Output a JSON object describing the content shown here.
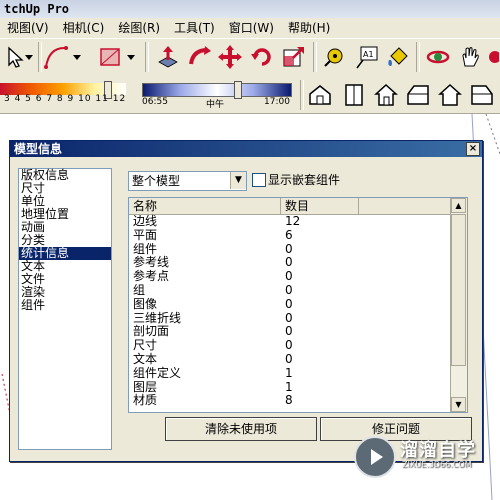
{
  "app": {
    "title": "tchUp Pro"
  },
  "menu": [
    {
      "label": "视图(V)"
    },
    {
      "label": "相机(C)"
    },
    {
      "label": "绘图(R)"
    },
    {
      "label": "工具(T)"
    },
    {
      "label": "窗口(W)"
    },
    {
      "label": "帮助(H)"
    }
  ],
  "toolbar": {
    "tools": [
      "select-arrow-icon",
      "arc-icon",
      "rectangle-icon",
      "push-pull-icon",
      "follow-me-icon",
      "move-icon",
      "rotate-icon",
      "scale-icon",
      "tape-measure-icon",
      "text-label-icon",
      "paint-bucket-icon",
      "orbit-icon",
      "pan-hand-icon"
    ],
    "text_tool_glyph": "A1",
    "views": [
      "iso-view-icon",
      "top-view-icon",
      "front-view-icon",
      "right-view-icon",
      "back-view-icon",
      "left-view-icon"
    ]
  },
  "shadow": {
    "month_ticks": "3 4 5 6 7 8 9 10 11 12",
    "time_start": "06:55",
    "time_mid": "中午",
    "time_end": "17:00"
  },
  "dialog": {
    "title": "模型信息",
    "categories": [
      {
        "label": "版权信息",
        "selected": false
      },
      {
        "label": "尺寸",
        "selected": false
      },
      {
        "label": "单位",
        "selected": false
      },
      {
        "label": "地理位置",
        "selected": false
      },
      {
        "label": "动画",
        "selected": false
      },
      {
        "label": "分类",
        "selected": false
      },
      {
        "label": "统计信息",
        "selected": true
      },
      {
        "label": "文本",
        "selected": false
      },
      {
        "label": "文件",
        "selected": false
      },
      {
        "label": "渲染",
        "selected": false
      },
      {
        "label": "组件",
        "selected": false
      }
    ],
    "scope_select": {
      "value": "整个模型"
    },
    "nested_checkbox": {
      "label": "显示嵌套组件",
      "checked": false
    },
    "table": {
      "headers": [
        "名称",
        "数目"
      ],
      "rows": [
        {
          "name": "边线",
          "count": "12"
        },
        {
          "name": "平面",
          "count": "6"
        },
        {
          "name": "组件",
          "count": "0"
        },
        {
          "name": "参考线",
          "count": "0"
        },
        {
          "name": "参考点",
          "count": "0"
        },
        {
          "name": "组",
          "count": "0"
        },
        {
          "name": "图像",
          "count": "0"
        },
        {
          "name": "三维折线",
          "count": "0"
        },
        {
          "name": "剖切面",
          "count": "0"
        },
        {
          "name": "尺寸",
          "count": "0"
        },
        {
          "name": "文本",
          "count": "0"
        },
        {
          "name": "组件定义",
          "count": "1"
        },
        {
          "name": "图层",
          "count": "1"
        },
        {
          "name": "材质",
          "count": "8"
        }
      ]
    },
    "buttons": {
      "purge": "清除未使用项",
      "fix": "修正问题"
    }
  },
  "watermark": {
    "main": "溜溜自学",
    "sub": "ZIXUE.3D66.COM"
  },
  "colors": {
    "dialog_title": "#0a246a",
    "selection": "#0a246a",
    "chrome": "#ece9d8"
  }
}
